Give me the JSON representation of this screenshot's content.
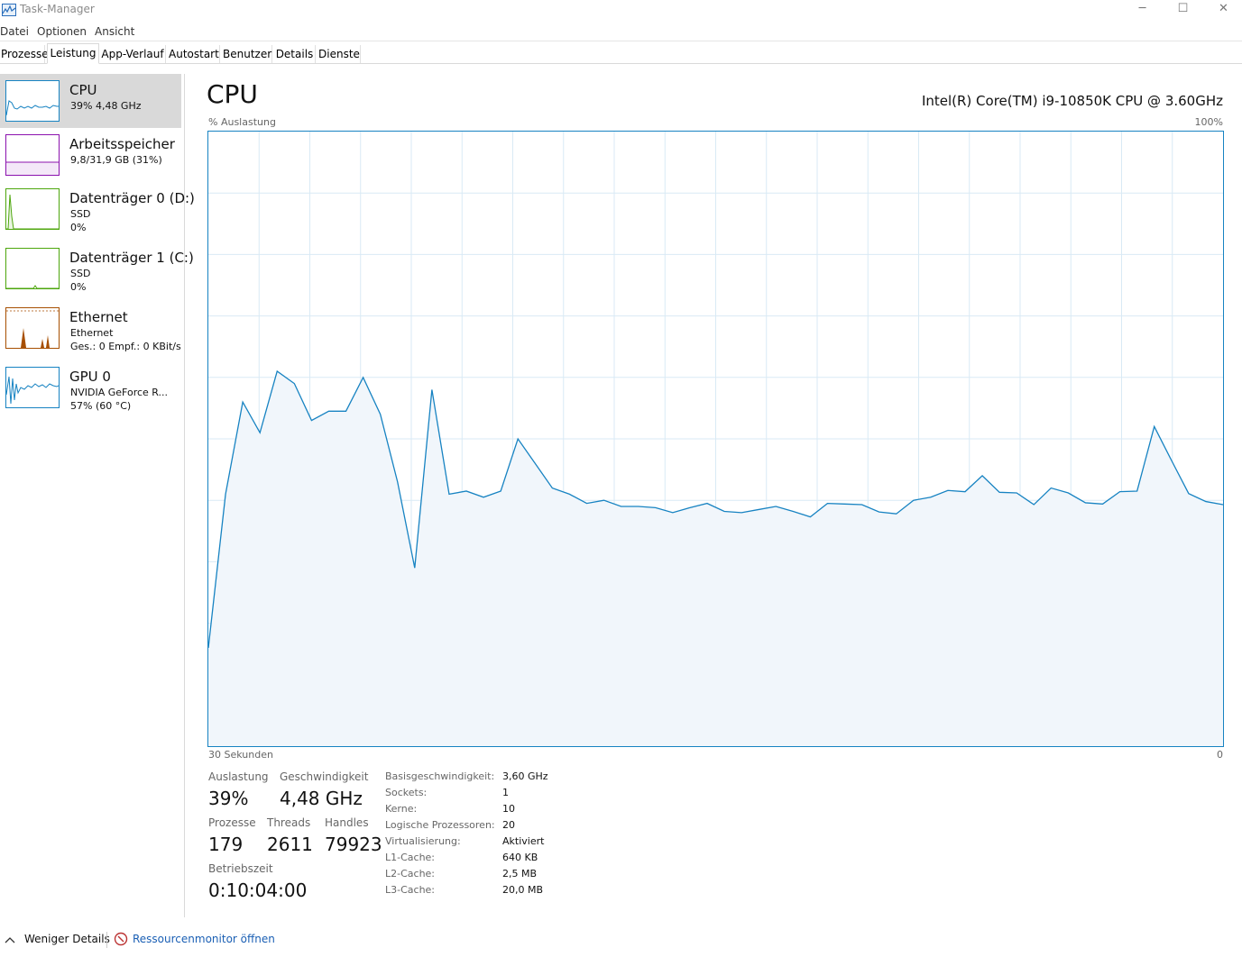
{
  "window": {
    "title": "Task-Manager",
    "minimize": "─",
    "maximize": "☐",
    "close": "✕"
  },
  "menu": [
    "Datei",
    "Optionen",
    "Ansicht"
  ],
  "tabs": [
    "Prozesse",
    "Leistung",
    "App-Verlauf",
    "Autostart",
    "Benutzer",
    "Details",
    "Dienste"
  ],
  "active_tab": "Leistung",
  "sidebar": [
    {
      "title": "CPU",
      "line1": "39%  4,48 GHz",
      "line2": "",
      "color": "#1783c2",
      "selected": true
    },
    {
      "title": "Arbeitsspeicher",
      "line1": "9,8/31,9 GB (31%)",
      "line2": "",
      "color": "#8b12ae",
      "selected": false
    },
    {
      "title": "Datenträger 0 (D:)",
      "line1": "SSD",
      "line2": "0%",
      "color": "#4da60c",
      "selected": false
    },
    {
      "title": "Datenträger 1 (C:)",
      "line1": "SSD",
      "line2": "0%",
      "color": "#4da60c",
      "selected": false
    },
    {
      "title": "Ethernet",
      "line1": "Ethernet",
      "line2": "Ges.: 0  Empf.: 0 KBit/s",
      "color": "#a74f01",
      "selected": false
    },
    {
      "title": "GPU 0",
      "line1": "NVIDIA GeForce R...",
      "line2": "57%  (60 °C)",
      "color": "#1783c2",
      "selected": false
    }
  ],
  "main": {
    "title": "CPU",
    "model": "Intel(R) Core(TM) i9-10850K CPU @ 3.60GHz",
    "y_label": "% Auslastung",
    "y_max": "100%",
    "x_label": "30 Sekunden",
    "x_min": "0"
  },
  "stats": {
    "auslastung_label": "Auslastung",
    "auslastung_value": "39%",
    "geschwindigkeit_label": "Geschwindigkeit",
    "geschwindigkeit_value": "4,48 GHz",
    "prozesse_label": "Prozesse",
    "prozesse_value": "179",
    "threads_label": "Threads",
    "threads_value": "2611",
    "handles_label": "Handles",
    "handles_value": "79923",
    "betriebszeit_label": "Betriebszeit",
    "betriebszeit_value": "0:10:04:00"
  },
  "specs": [
    {
      "label": "Basisgeschwindigkeit:",
      "value": "3,60 GHz"
    },
    {
      "label": "Sockets:",
      "value": "1"
    },
    {
      "label": "Kerne:",
      "value": "10"
    },
    {
      "label": "Logische Prozessoren:",
      "value": "20"
    },
    {
      "label": "Virtualisierung:",
      "value": "Aktiviert"
    },
    {
      "label": "L1-Cache:",
      "value": "640 KB"
    },
    {
      "label": "L2-Cache:",
      "value": "2,5 MB"
    },
    {
      "label": "L3-Cache:",
      "value": "20,0 MB"
    }
  ],
  "footer": {
    "less_details": "Weniger Details",
    "resource_monitor": "Ressourcenmonitor öffnen"
  },
  "chart_data": {
    "type": "area",
    "title": "",
    "xlabel": "30 Sekunden",
    "ylabel": "% Auslastung",
    "ylim": [
      0,
      100
    ],
    "grid": true,
    "line_color": "#1783c2",
    "fill_color": "#f1f6fb",
    "grid_color": "#d9eaf5",
    "x": [
      0,
      1,
      2,
      3,
      4,
      5,
      6,
      7,
      8,
      9,
      10,
      11,
      12,
      13,
      14,
      15,
      16,
      17,
      18,
      19,
      20,
      21,
      22,
      23,
      24,
      25,
      26,
      27,
      28,
      29,
      30,
      31,
      32,
      33,
      34,
      35,
      36,
      37,
      38,
      39,
      40,
      41,
      42,
      43,
      44,
      45,
      46,
      47,
      48,
      49,
      50,
      51,
      52,
      53,
      54,
      55,
      56,
      57,
      58,
      59
    ],
    "values": [
      16,
      41,
      56,
      51,
      61,
      59,
      53,
      54.5,
      54.5,
      60,
      54,
      43,
      29,
      58,
      41,
      41.5,
      40.5,
      41.5,
      50,
      46,
      42,
      41,
      39.5,
      40,
      39,
      39,
      38.8,
      38,
      38.8,
      39.5,
      38.2,
      38,
      38.5,
      39,
      38.2,
      37.3,
      39.5,
      39.4,
      39.3,
      38.1,
      37.8,
      40,
      40.5,
      41.6,
      41.4,
      44,
      41.3,
      41.2,
      39.3,
      42,
      41.2,
      39.6,
      39.4,
      41.4,
      41.5,
      52,
      46.5,
      41.1,
      39.8,
      39.3
    ]
  }
}
